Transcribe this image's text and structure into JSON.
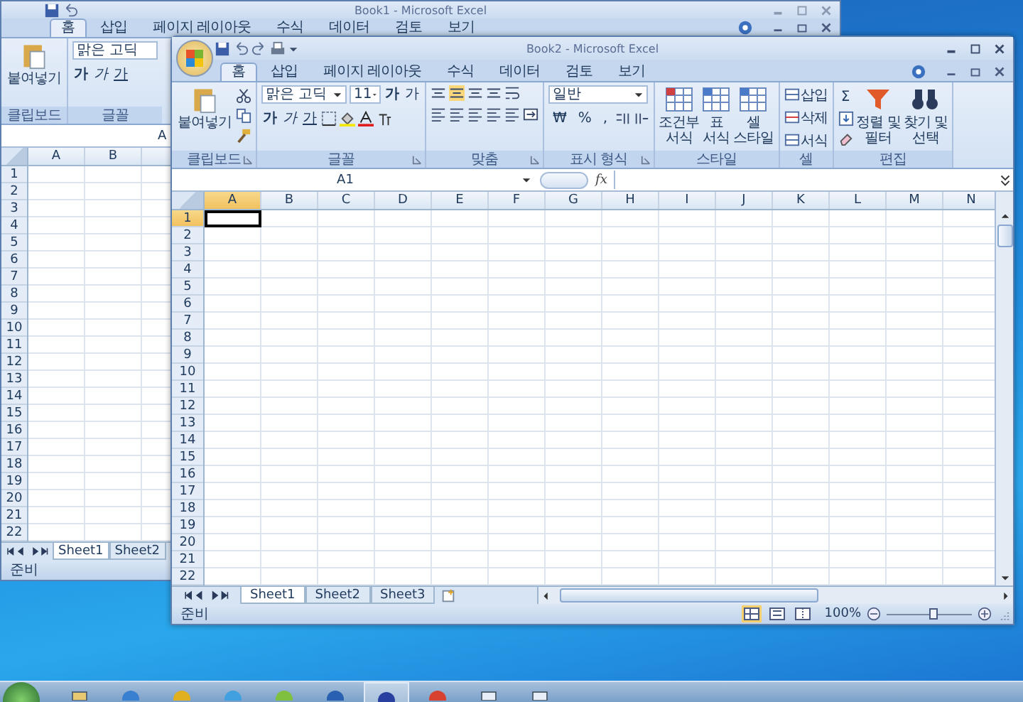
{
  "back_window": {
    "title": "Book1 - Microsoft Excel",
    "tabs": [
      {
        "label": "홈",
        "selected": true
      },
      {
        "label": "삽입",
        "selected": false
      },
      {
        "label": "페이지 레이아웃",
        "selected": false
      },
      {
        "label": "수식",
        "selected": false
      },
      {
        "label": "데이터",
        "selected": false
      },
      {
        "label": "검토",
        "selected": false
      },
      {
        "label": "보기",
        "selected": false
      }
    ],
    "paste_label": "붙여넣기",
    "clipboard_label": "클립보드",
    "font_name": "맑은 고딕",
    "style_buttons": [
      "가",
      "가",
      "가"
    ],
    "font_label": "글꼴",
    "name_box": "A",
    "columns": [
      {
        "label": "A",
        "selected": false
      },
      {
        "label": "B",
        "selected": false
      }
    ],
    "rows": [
      "1",
      "2",
      "3",
      "4",
      "5",
      "6",
      "7",
      "8",
      "9",
      "10",
      "11",
      "12",
      "13",
      "14",
      "15",
      "16",
      "17",
      "18",
      "19",
      "20",
      "21",
      "22"
    ],
    "sheet_tabs": [
      {
        "label": "Sheet1",
        "selected": true
      },
      {
        "label": "Sheet2",
        "selected": false
      }
    ],
    "status": "준비"
  },
  "front_window": {
    "title": "Book2 - Microsoft Excel",
    "tabs": [
      {
        "label": "홈",
        "selected": true
      },
      {
        "label": "삽입",
        "selected": false
      },
      {
        "label": "페이지 레이아웃",
        "selected": false
      },
      {
        "label": "수식",
        "selected": false
      },
      {
        "label": "데이터",
        "selected": false
      },
      {
        "label": "검토",
        "selected": false
      },
      {
        "label": "보기",
        "selected": false
      }
    ],
    "ribbon": [
      {
        "kind": "clipboard",
        "label": "클립보드",
        "paste_label": "붙여넣기"
      },
      {
        "kind": "font",
        "label": "글꼴",
        "font_name": "맑은 고딕",
        "font_size": "11",
        "size_buttons": [
          "가",
          "가"
        ],
        "style_buttons": [
          "가",
          "가",
          "가"
        ]
      },
      {
        "kind": "alignment",
        "label": "맞춤"
      },
      {
        "kind": "number",
        "label": "표시 형식",
        "format": "일반",
        "buttons": [
          "₩",
          "%",
          ","
        ]
      },
      {
        "kind": "styles",
        "label": "스타일",
        "items": [
          {
            "lines": [
              "조건부",
              "서식"
            ]
          },
          {
            "lines": [
              "표",
              "서식"
            ]
          },
          {
            "lines": [
              "셀",
              "스타일"
            ]
          }
        ]
      },
      {
        "kind": "cells",
        "label": "셀",
        "items": [
          "삽입",
          "삭제",
          "서식"
        ]
      },
      {
        "kind": "editing",
        "label": "편집",
        "sum": "Σ",
        "items": [
          {
            "lines": [
              "정렬 및",
              "필터"
            ]
          },
          {
            "lines": [
              "찾기 및",
              "선택"
            ]
          }
        ]
      }
    ],
    "name_box": "A1",
    "fx": "fx",
    "columns": [
      {
        "label": "A",
        "selected": true
      },
      {
        "label": "B",
        "selected": false
      },
      {
        "label": "C",
        "selected": false
      },
      {
        "label": "D",
        "selected": false
      },
      {
        "label": "E",
        "selected": false
      },
      {
        "label": "F",
        "selected": false
      },
      {
        "label": "G",
        "selected": false
      },
      {
        "label": "H",
        "selected": false
      },
      {
        "label": "I",
        "selected": false
      },
      {
        "label": "J",
        "selected": false
      },
      {
        "label": "K",
        "selected": false
      },
      {
        "label": "L",
        "selected": false
      },
      {
        "label": "M",
        "selected": false
      },
      {
        "label": "N",
        "selected": false
      }
    ],
    "rows": [
      {
        "label": "1",
        "selected": true
      },
      {
        "label": "2",
        "selected": false
      },
      {
        "label": "3",
        "selected": false
      },
      {
        "label": "4",
        "selected": false
      },
      {
        "label": "5",
        "selected": false
      },
      {
        "label": "6",
        "selected": false
      },
      {
        "label": "7",
        "selected": false
      },
      {
        "label": "8",
        "selected": false
      },
      {
        "label": "9",
        "selected": false
      },
      {
        "label": "10",
        "selected": false
      },
      {
        "label": "11",
        "selected": false
      },
      {
        "label": "12",
        "selected": false
      },
      {
        "label": "13",
        "selected": false
      },
      {
        "label": "14",
        "selected": false
      },
      {
        "label": "15",
        "selected": false
      },
      {
        "label": "16",
        "selected": false
      },
      {
        "label": "17",
        "selected": false
      },
      {
        "label": "18",
        "selected": false
      },
      {
        "label": "19",
        "selected": false
      },
      {
        "label": "20",
        "selected": false
      },
      {
        "label": "21",
        "selected": false
      },
      {
        "label": "22",
        "selected": false
      }
    ],
    "sheet_tabs": [
      {
        "label": "Sheet1",
        "selected": true
      },
      {
        "label": "Sheet2",
        "selected": false
      },
      {
        "label": "Sheet3",
        "selected": false
      }
    ],
    "status": "준비",
    "views": [
      {
        "kind": "normal",
        "selected": true
      },
      {
        "kind": "page_layout",
        "selected": false
      },
      {
        "kind": "page_break",
        "selected": false
      }
    ],
    "zoom": {
      "reading": "100%",
      "level": 0.55
    }
  }
}
